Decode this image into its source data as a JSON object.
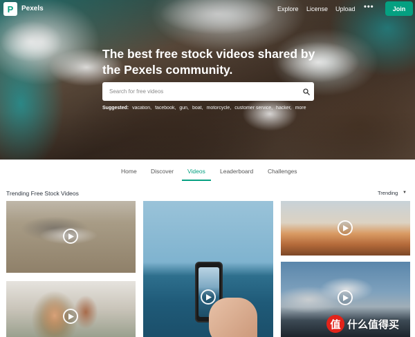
{
  "header": {
    "logo_letter": "P",
    "brand": "Pexels",
    "nav": [
      "Explore",
      "License",
      "Upload"
    ],
    "more": "•••",
    "join_label": "Join"
  },
  "hero": {
    "headline": "The best free stock videos shared by the Pexels community.",
    "search_placeholder": "Search for free videos",
    "suggested_label": "Suggested:",
    "suggestions": [
      "vacation,",
      "facebook,",
      "gun,",
      "boat,",
      "motorcycle,",
      "customer service,",
      "hacker,",
      "more"
    ]
  },
  "tabs": [
    "Home",
    "Discover",
    "Videos",
    "Leaderboard",
    "Challenges"
  ],
  "active_tab": "Videos",
  "section": {
    "title": "Trending Free Stock Videos",
    "sort_label": "Trending"
  },
  "watermark": {
    "badge": "值",
    "text": "什么值得买"
  },
  "colors": {
    "accent": "#05a081",
    "watermark_red": "#e2231a"
  }
}
